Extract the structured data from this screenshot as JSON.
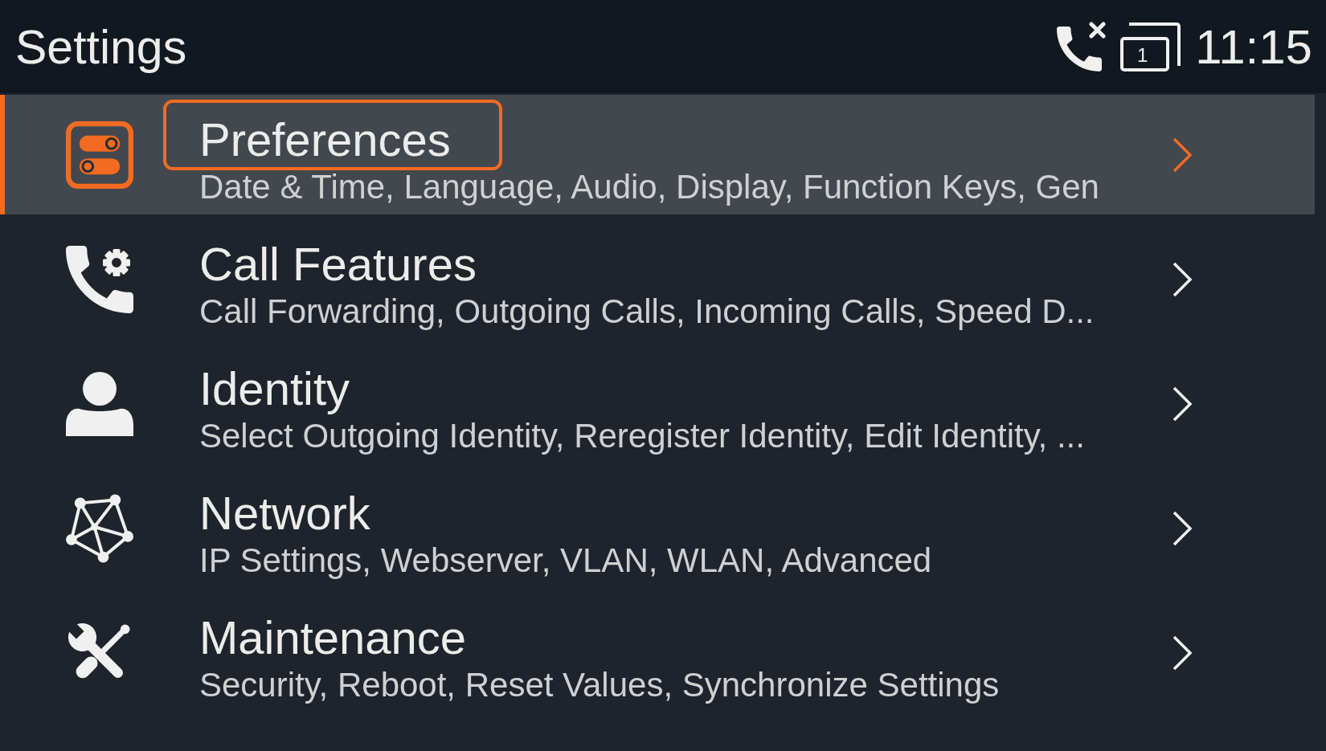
{
  "header": {
    "title": "Settings",
    "status": {
      "line_number": "1",
      "time": "11:15"
    }
  },
  "items": [
    {
      "title": "Preferences",
      "subtitle": "Date & Time, Language, Audio, Display, Function Keys, Gen",
      "selected": true
    },
    {
      "title": "Call Features",
      "subtitle": "Call Forwarding, Outgoing Calls, Incoming Calls, Speed D...",
      "selected": false
    },
    {
      "title": "Identity",
      "subtitle": "Select Outgoing Identity, Reregister Identity, Edit Identity, ...",
      "selected": false
    },
    {
      "title": "Network",
      "subtitle": "IP Settings, Webserver, VLAN, WLAN, Advanced",
      "selected": false
    },
    {
      "title": "Maintenance",
      "subtitle": "Security, Reboot, Reset Values, Synchronize Settings",
      "selected": false
    }
  ]
}
